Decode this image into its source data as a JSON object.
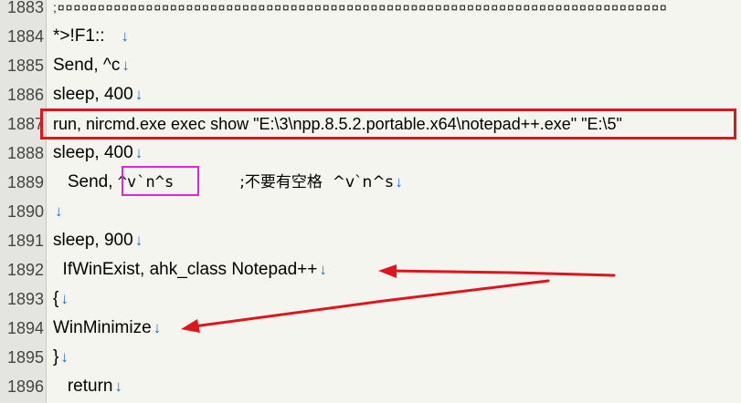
{
  "lines": [
    {
      "num": "1883",
      "text": ";¤¤¤¤¤¤¤¤¤¤¤¤¤¤¤¤¤¤¤¤¤¤¤¤¤¤¤¤¤¤¤¤¤¤¤¤¤¤¤¤¤¤¤¤¤¤¤¤¤¤¤¤¤¤¤¤¤¤¤¤¤¤¤¤¤¤¤¤¤¤¤¤¤¤¤¤"
    },
    {
      "num": "1884",
      "text": "*>!F1::"
    },
    {
      "num": "1885",
      "text": "Send, ^c"
    },
    {
      "num": "1886",
      "text": "sleep, 400"
    },
    {
      "num": "1887",
      "text": "run, nircmd.exe exec show \"E:\\3\\npp.8.5.2.portable.x64\\notepad++.exe\" \"E:\\5\""
    },
    {
      "num": "1888",
      "text": "sleep, 400"
    },
    {
      "num": "1889",
      "text_prefix": "   Send, ",
      "text_highlight": "^v`n^s",
      "comment": ";不要有空格  ^v`n^s"
    },
    {
      "num": "1890",
      "text": ""
    },
    {
      "num": "1891",
      "text": "sleep, 900"
    },
    {
      "num": "1892",
      "text": "  IfWinExist, ahk_class Notepad++"
    },
    {
      "num": "1893",
      "text": "{"
    },
    {
      "num": "1894",
      "text": "WinMinimize"
    },
    {
      "num": "1895",
      "text": "}"
    },
    {
      "num": "1896",
      "text": "   return"
    }
  ],
  "newline_glyph": "↓",
  "colors": {
    "annotation_red": "#e0141c",
    "annotation_magenta": "#e024d8",
    "newline_blue": "#1e6fd6",
    "gutter_bg": "#e4e4e0",
    "editor_bg": "#f5f5ef"
  }
}
